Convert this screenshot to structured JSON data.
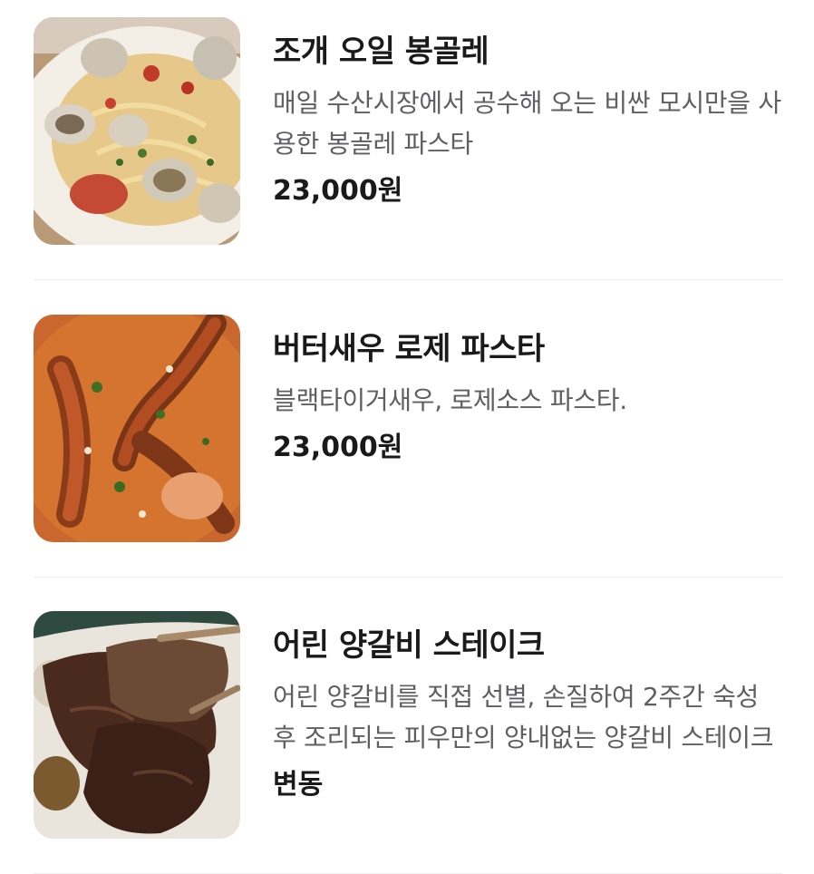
{
  "menu": {
    "items": [
      {
        "name": "조개 오일 봉골레",
        "description": "매일 수산시장에서 공수해 오는 비싼 모시만을 사용한 봉골레 파스타",
        "price": "23,000원",
        "image_icon": "clam-pasta-photo"
      },
      {
        "name": "버터새우 로제 파스타",
        "description": "블랙타이거새우, 로제소스 파스타.",
        "price": "23,000원",
        "image_icon": "shrimp-rose-pasta-photo"
      },
      {
        "name": "어린 양갈비 스테이크",
        "description": "어린 양갈비를 직접 선별, 손질하여 2주간 숙성 후 조리되는 피우만의 양내없는 양갈비 스테이크",
        "price": "변동",
        "image_icon": "lamb-chop-steak-photo"
      }
    ]
  }
}
